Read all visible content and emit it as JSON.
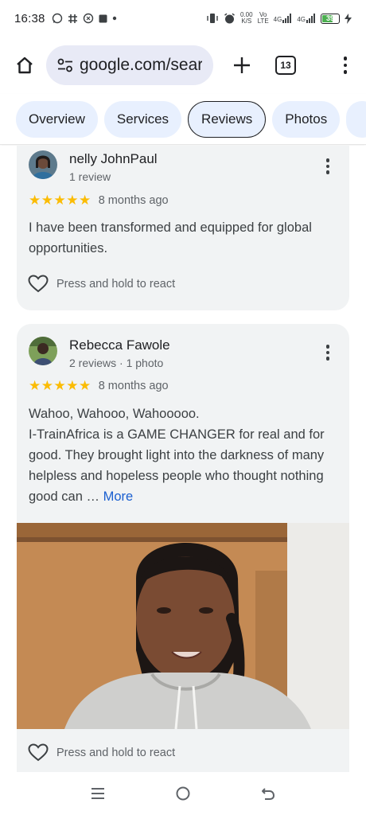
{
  "status_bar": {
    "time": "16:38",
    "net_speed": "0.00",
    "net_unit": "K/S",
    "lte_top": "Vo",
    "lte_bottom": "LTE",
    "sig1": "4G",
    "sig2": "4G",
    "battery": "39"
  },
  "browser": {
    "url": "google.com/search",
    "tab_count": "13"
  },
  "chips": [
    {
      "label": "Overview"
    },
    {
      "label": "Services"
    },
    {
      "label": "Reviews",
      "active": true
    },
    {
      "label": "Photos"
    }
  ],
  "reviews": [
    {
      "name": "nelly JohnPaul",
      "meta": "1 review",
      "stars": "★★★★★",
      "when": "8 months ago",
      "text": "I have been transformed and equipped for global opportunities.",
      "react_label": "Press and hold to react"
    },
    {
      "name": "Rebecca Fawole",
      "meta": "2 reviews · 1 photo",
      "stars": "★★★★★",
      "when": "8 months ago",
      "text_line1": "Wahoo, Wahooo, Wahooooo.",
      "text_rest": "I-TrainAfrica is a GAME CHANGER for real and for good. They brought light into the darkness of many helpless and hopeless people who thought nothing good can …",
      "more_label": "More",
      "react_label": "Press and hold to react"
    }
  ],
  "colors": {
    "star": "#fbbc04",
    "link": "#1a5fd0",
    "chip_bg": "#e8f0fe",
    "card_bg": "#f1f3f4"
  },
  "icons": {
    "home": "home-icon",
    "tune": "site-settings-icon",
    "plus": "new-tab-icon",
    "tabs": "tab-switcher-icon",
    "menu": "more-vert-icon",
    "heart": "heart-outline-icon",
    "nav_recents": "recents-icon",
    "nav_home": "nav-home-icon",
    "nav_back": "back-icon"
  }
}
